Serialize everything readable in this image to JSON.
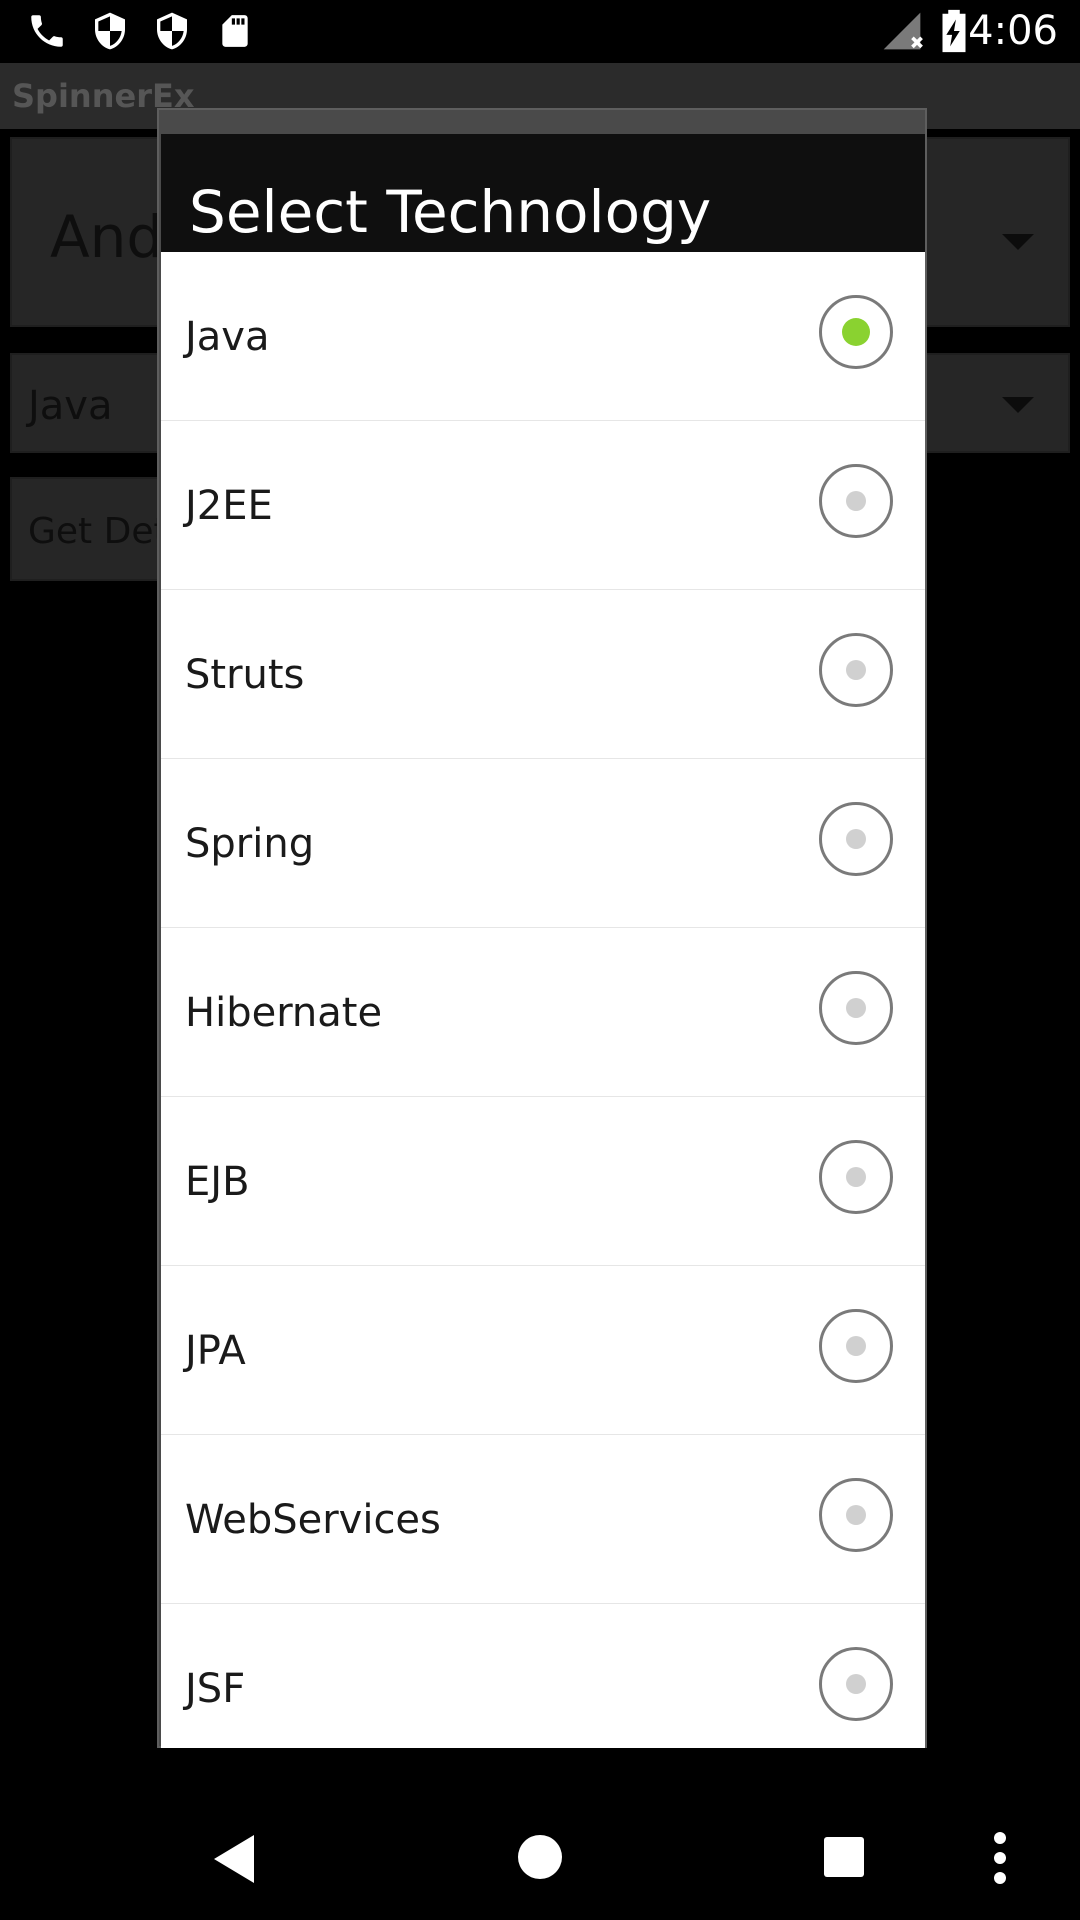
{
  "status_bar": {
    "time": "4:06",
    "icons": [
      "phone-icon",
      "shield-icon",
      "shield-icon",
      "sd-card-icon",
      "signal-off-icon",
      "battery-charging-icon"
    ]
  },
  "app": {
    "title": "SpinnerEx",
    "spinner1_value": "Android",
    "spinner2_value": "Java",
    "details_button_label": "Get Details"
  },
  "dialog": {
    "title": "Select Technology",
    "selected_index": 0,
    "options": [
      "Java",
      "J2EE",
      "Struts",
      "Spring",
      "Hibernate",
      "EJB",
      "JPA",
      "WebServices",
      "JSF"
    ]
  },
  "colors": {
    "radio_selected": "#8ad230",
    "dialog_header": "#0f0f0f",
    "list_background": "#ffffff"
  },
  "nav_bar": {
    "buttons": [
      "back-icon",
      "home-icon",
      "recents-icon",
      "overflow-menu-icon"
    ]
  }
}
